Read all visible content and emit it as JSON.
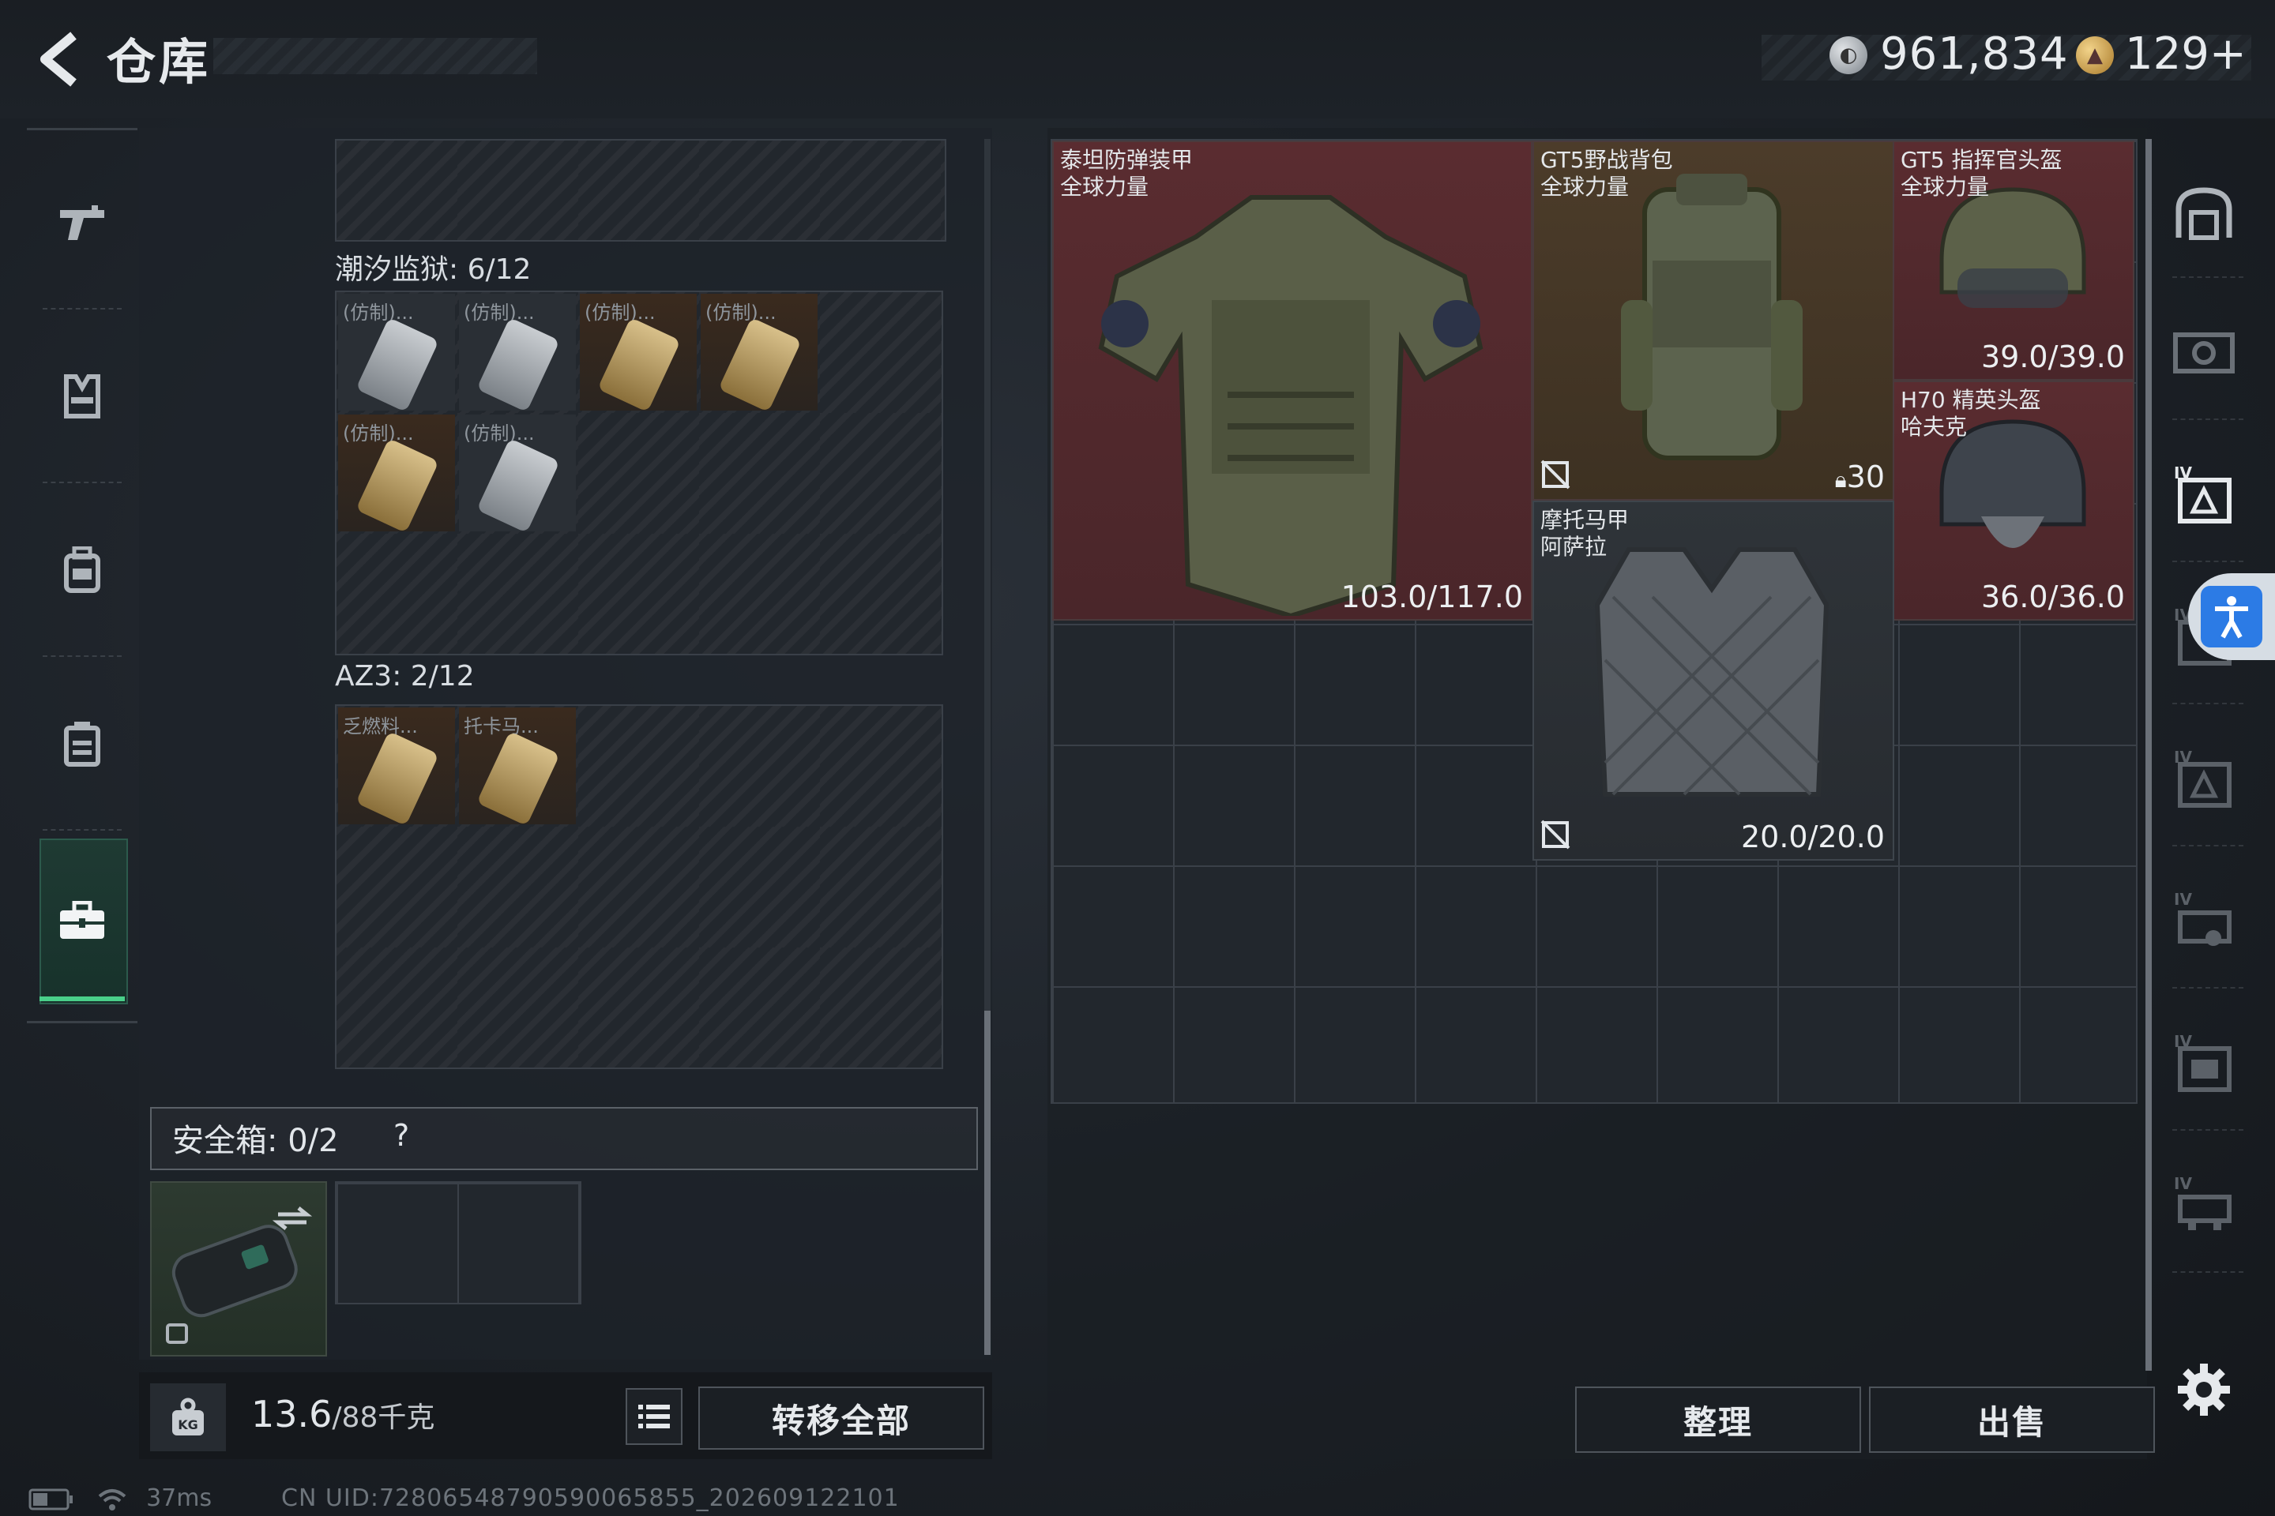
{
  "header": {
    "title": "仓库",
    "silver": "961,834",
    "gold": "129+"
  },
  "left_rail": {
    "items": [
      {
        "icon": "gun-icon"
      },
      {
        "icon": "vest-icon"
      },
      {
        "icon": "backpack-icon"
      },
      {
        "icon": "bag-icon"
      },
      {
        "icon": "toolbox-icon",
        "active": true
      }
    ]
  },
  "left_panel": {
    "container1": {
      "label": "潮汐监狱: 6/12",
      "slots": [
        {
          "tag": "(仿制)...",
          "tone": "grey"
        },
        {
          "tag": "(仿制)...",
          "tone": "grey"
        },
        {
          "tag": "(仿制)...",
          "tone": "orange"
        },
        {
          "tag": "(仿制)...",
          "tone": "orange"
        },
        {
          "tag": "(仿制)...",
          "tone": "orange"
        },
        {
          "tag": "(仿制)...",
          "tone": "grey"
        }
      ]
    },
    "container2": {
      "label": "AZ3: 2/12",
      "slots": [
        {
          "tag": "乏燃料...",
          "tone": "orange"
        },
        {
          "tag": "托卡马...",
          "tone": "orange"
        }
      ]
    },
    "safe_box": {
      "label": "安全箱: 0/2",
      "help": "?"
    }
  },
  "weight": {
    "current": "13.6",
    "capacity": "/88千克",
    "transfer_label": "转移全部"
  },
  "stash_items": [
    {
      "name": "泰坦防弹装甲\n全球力量",
      "value": "103.0/117.0",
      "tone": "red"
    },
    {
      "name": "GT5野战背包\n全球力量",
      "value": "30",
      "tone": "gold"
    },
    {
      "name": "GT5 指挥官头盔\n全球力量",
      "value": "39.0/39.0",
      "tone": "red"
    },
    {
      "name": "H70 精英头盔\n哈夫克",
      "value": "36.0/36.0",
      "tone": "red"
    },
    {
      "name": "摩托马甲\n阿萨拉",
      "value": "20.0/20.0",
      "tone": "grey"
    }
  ],
  "right_buttons": {
    "sort": "整理",
    "sell": "出售"
  },
  "right_rail": {
    "tier_label": "IV"
  },
  "status": {
    "latency": "37ms",
    "uid": "CN UID:72806548790590065855_202609122101"
  },
  "colors": {
    "accent_green": "#49d08a",
    "item_red": "#5a2c30",
    "item_gold": "#4c3c2a",
    "accessibility_blue": "#2c7be5"
  }
}
